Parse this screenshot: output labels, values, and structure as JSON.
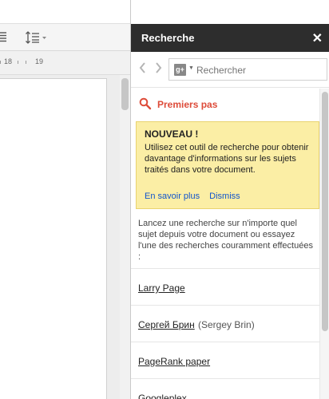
{
  "ruler": {
    "num_18": "18",
    "num_19": "19"
  },
  "panel": {
    "title": "Recherche",
    "close_glyph": "✕",
    "nav_back_glyph": "‹",
    "nav_forward_glyph": "›",
    "search_provider_icon": "google-plus-icon",
    "search_provider_glyph": "g+",
    "search_placeholder": "Rechercher"
  },
  "section": {
    "icon": "search-icon",
    "title": "Premiers pas"
  },
  "notice": {
    "title": "NOUVEAU !",
    "body": "Utilisez cet outil de recherche pour obtenir davantage d'informations sur les sujets traités dans votre document.",
    "learn_more": "En savoir plus",
    "dismiss": "Dismiss"
  },
  "intro": "Lancez une recherche sur n'importe quel sujet depuis votre document ou essayez l'une des recherches couramment effectuées :",
  "results": [
    {
      "link": "Larry Page",
      "extra": ""
    },
    {
      "link": "Сергей Брин",
      "extra": "(Sergey Brin)"
    },
    {
      "link": "PageRank paper",
      "extra": ""
    },
    {
      "link": "Googleplex",
      "extra": ""
    }
  ],
  "colors": {
    "accent_red": "#dd4b39",
    "header_dark": "#2d2d2d",
    "notice_yellow": "#fbeea5",
    "link_blue": "#1155cc"
  }
}
